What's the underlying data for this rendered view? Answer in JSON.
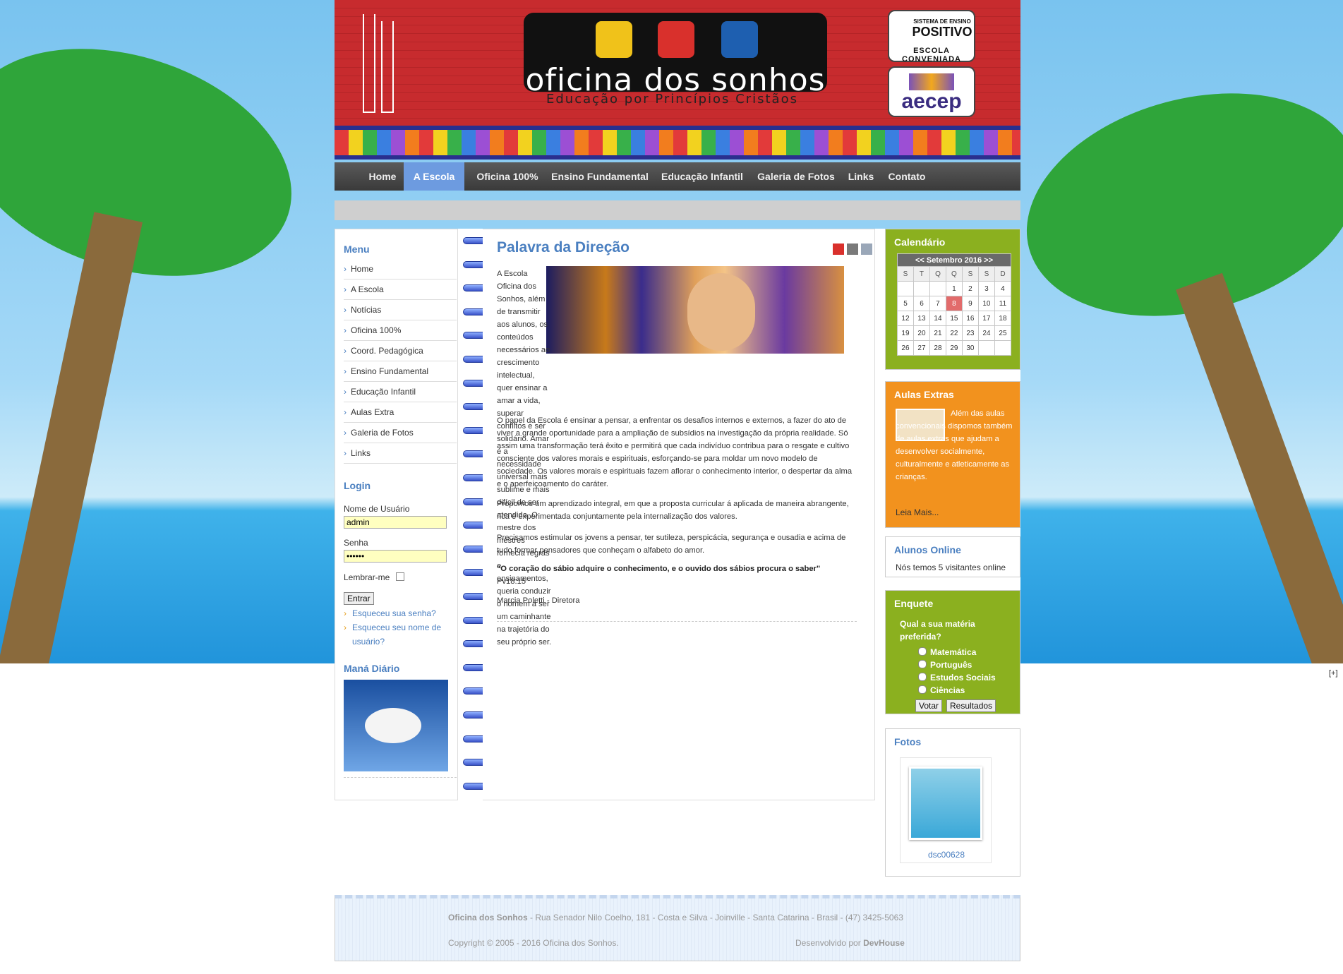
{
  "header": {
    "logo_title": "oficina dos sonhos",
    "logo_subtitle": "Educação por Princípios Cristãos",
    "badge1_top": "SISTEMA DE ENSINO",
    "badge1_name": "POSITIVO",
    "badge1_bottom": "ESCOLA CONVENIADA",
    "badge2_name": "aecep"
  },
  "nav": {
    "items": [
      "Home",
      "A Escola",
      "Oficina 100%",
      "Ensino Fundamental",
      "Educação Infantil",
      "Galeria de Fotos",
      "Links",
      "Contato"
    ],
    "active": "A Escola"
  },
  "sidebar": {
    "menu_title": "Menu",
    "menu": [
      "Home",
      "A Escola",
      "Notícias",
      "Oficina 100%",
      "Coord. Pedagógica",
      "Ensino Fundamental",
      "Educação Infantil",
      "Aulas Extra",
      "Galeria de Fotos",
      "Links"
    ],
    "login_title": "Login",
    "username_label": "Nome de Usuário",
    "username_value": "admin",
    "password_label": "Senha",
    "password_value": "••••••",
    "remember_label": "Lembrar-me",
    "submit": "Entrar",
    "forgot_password": "Esqueceu sua senha?",
    "forgot_username": "Esqueceu seu nome de usuário?",
    "mana_title": "Maná Diário"
  },
  "article": {
    "title": "Palavra da Direção",
    "p1": "A Escola Oficina dos Sonhos, além de transmitir aos alunos, os conteúdos necessários ao crescimento intelectual, quer ensinar a amar a vida, superar conflitos e ser solidário. Amar é a necessidade universal mais sublime e mais difícil de ser atendida. O mestre dos mestres fornecia regras e ensinamentos, queria conduzir o homem a ser um caminhante na trajetória do seu próprio ser.",
    "p2": "O papel da Escola é ensinar a pensar, a enfrentar os desafios internos e externos, a fazer do ato de viver a grande oportunidade para a ampliação de subsídios na investigação da própria realidade. Só assim uma transformação terá êxito e permitirá que cada indivíduo contribua para o resgate e cultivo consciente dos valores morais e espirituais, esforçando-se para moldar um novo modelo de sociedade. Os valores morais e espirituais fazem aflorar o conhecimento interior, o despertar da alma e o aperfeiçoamento do caráter.",
    "p3": "Propomos um aprendizado integral, em que a proposta curricular á aplicada de maneira abrangente, rica e experimentada conjuntamente pela internalização dos valores.",
    "p4": "Precisamos estimular os jovens a pensar, ter sutileza, perspicácia, segurança e ousadia e acima de tudo formar pensadores que conheçam o alfabeto do amor.",
    "quote": "\"O coração do sábio adquire o conhecimento, e o ouvido dos sábios procura o saber\"",
    "ref": "Pv18:15",
    "signature": "Marcia Poletti - Diretora"
  },
  "calendar": {
    "title": "Calendário",
    "month": "<<  Setembro 2016  >>",
    "days": [
      "S",
      "T",
      "Q",
      "Q",
      "S",
      "S",
      "D"
    ],
    "weeks": [
      [
        "",
        "",
        "",
        "1",
        "2",
        "3",
        "4"
      ],
      [
        "5",
        "6",
        "7",
        "8",
        "9",
        "10",
        "11"
      ],
      [
        "12",
        "13",
        "14",
        "15",
        "16",
        "17",
        "18"
      ],
      [
        "19",
        "20",
        "21",
        "22",
        "23",
        "24",
        "25"
      ],
      [
        "26",
        "27",
        "28",
        "29",
        "30",
        "",
        ""
      ]
    ],
    "today": "8"
  },
  "aulas": {
    "title": "Aulas Extras",
    "text": "Além das aulas convencionais dispomos também de aulas extras que ajudam a desenvolver socialmente, culturalmente e atleticamente as crianças.",
    "more": "Leia Mais..."
  },
  "online": {
    "title": "Alunos Online",
    "text": "Nós temos 5 visitantes online"
  },
  "poll": {
    "title": "Enquete",
    "question": "Qual a sua matéria preferida?",
    "options": [
      "Matemática",
      "Português",
      "Estudos Sociais",
      "Ciências"
    ],
    "vote": "Votar",
    "results": "Resultados"
  },
  "photos": {
    "title": "Fotos",
    "caption": "dsc00628"
  },
  "footer": {
    "name": "Oficina dos Sonhos",
    "address": " - Rua Senador Nilo Coelho, 181 - Costa e Silva - Joinville - Santa Catarina - Brasil - (47) 3425-5063",
    "copyright": "Copyright © 2005 - 2016 Oficina dos Sonhos.",
    "dev_prefix": "Desenvolvido por ",
    "dev": "DevHouse"
  },
  "corner": "[+]",
  "colors": {
    "accent": "#4a7fc0",
    "nav_active": "#6d9be0",
    "green": "#8bb01f",
    "orange": "#f2921e",
    "header_red": "#c72b2e"
  }
}
